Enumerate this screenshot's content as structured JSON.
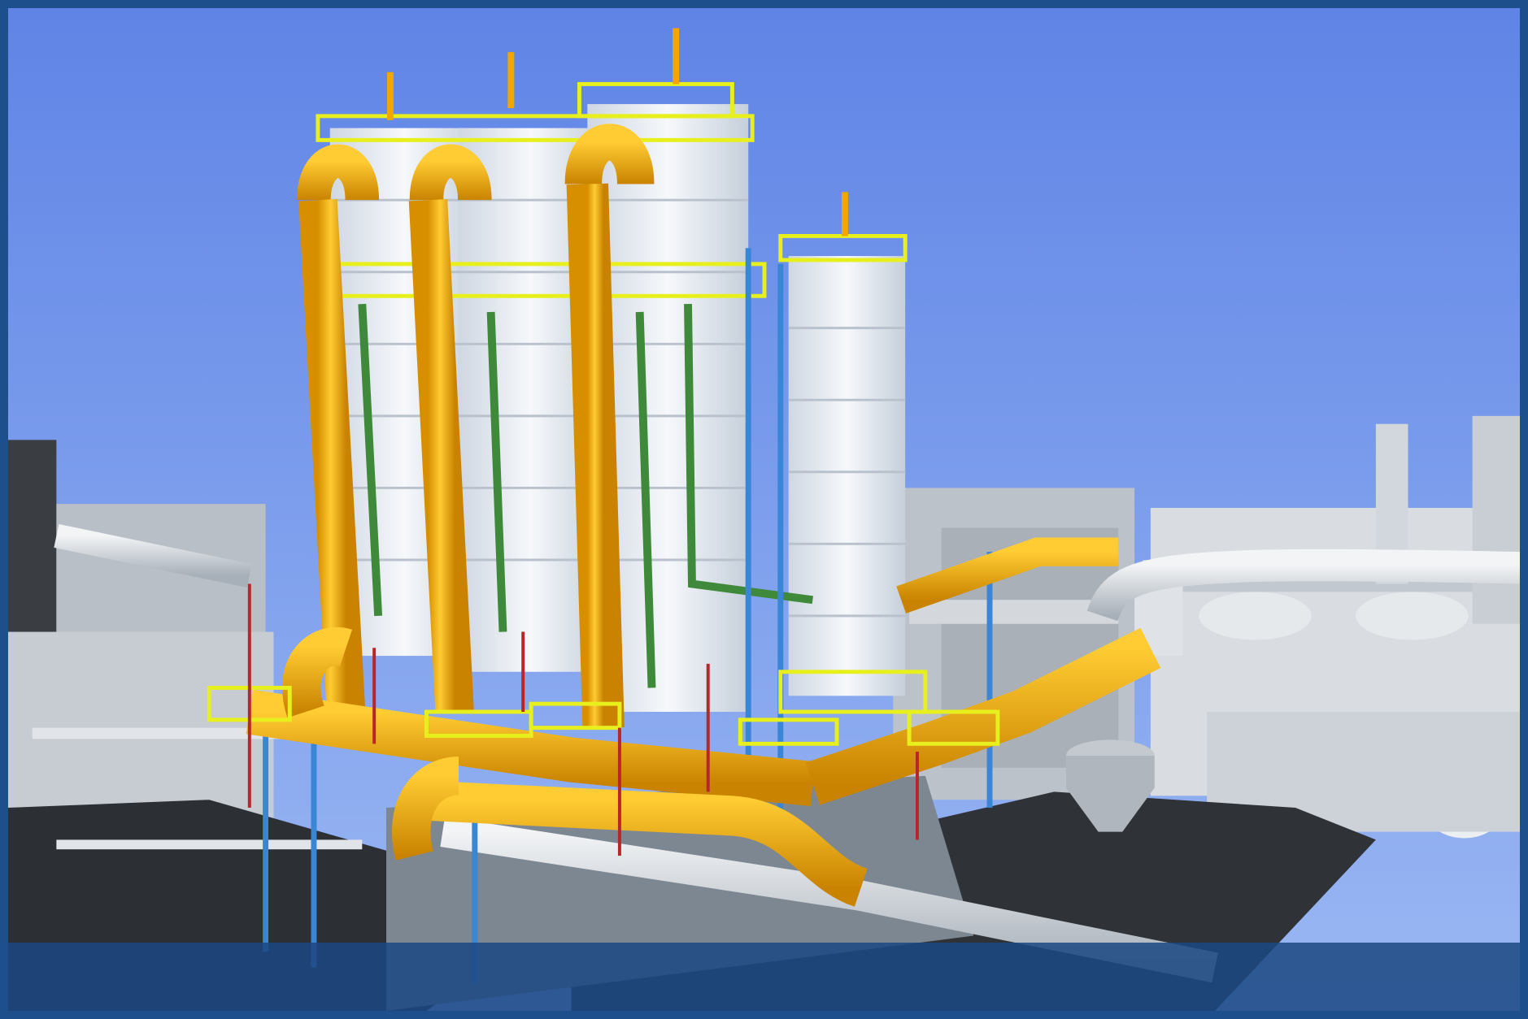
{
  "image": {
    "alt_kind": "3d-plant-model-render",
    "colors": {
      "frame": "#1d4f8c",
      "sky_top": "#5f84e6",
      "sky_bottom": "#9bb8f3",
      "vessel_white": "#e9eef4",
      "pipe_yellow": "#f2a700",
      "platform_yellow": "#e7ef1d",
      "pipe_green": "#3f8a3a",
      "steel_blue": "#3a86d6",
      "grey": "#9aa3ad",
      "dark_ground": "#2c2f33",
      "caption_bar": "#1c4882"
    }
  },
  "caption": {
    "text": ""
  }
}
